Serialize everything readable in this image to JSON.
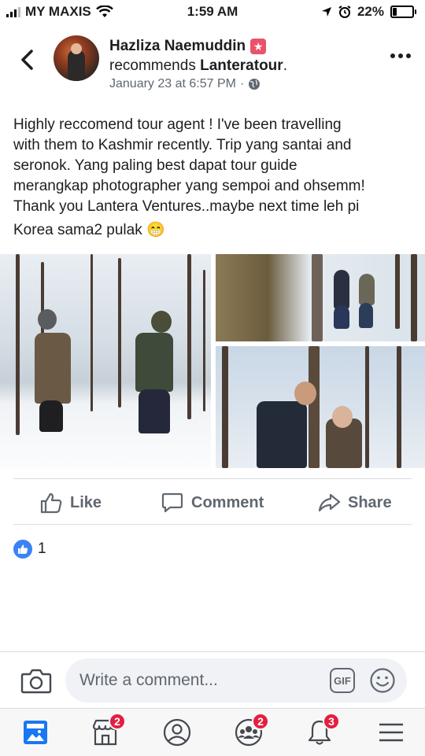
{
  "status_bar": {
    "carrier": "MY MAXIS",
    "time": "1:59 AM",
    "battery": "22%",
    "battery_level": 0.22
  },
  "post": {
    "author": "Hazliza Naemuddin",
    "recommends_prefix": "recommends",
    "page_name": "Lanteratour",
    "recommends_suffix": ".",
    "timestamp": "January 23 at 6:57 PM",
    "separator": "·",
    "text_lines": [
      "Highly reccomend tour agent ! I've been travelling",
      "with them to Kashmir recently.  Trip yang santai and",
      "seronok. Yang paling best dapat tour guide",
      "merangkap photographer yang sempoi and ohsemm!",
      "Thank you Lantera Ventures..maybe next time leh pi",
      "Korea sama2 pulak"
    ],
    "emoji": "😁"
  },
  "actions": {
    "like": "Like",
    "comment": "Comment",
    "share": "Share"
  },
  "reactions": {
    "count": "1"
  },
  "comment_box": {
    "placeholder": "Write a comment...",
    "gif_label": "GIF"
  },
  "nav": {
    "marketplace_badge": "2",
    "groups_badge": "2",
    "notifications_badge": "3"
  },
  "colors": {
    "accent": "#1877f2",
    "badge": "#e41e3f",
    "muted_text": "#606770"
  }
}
